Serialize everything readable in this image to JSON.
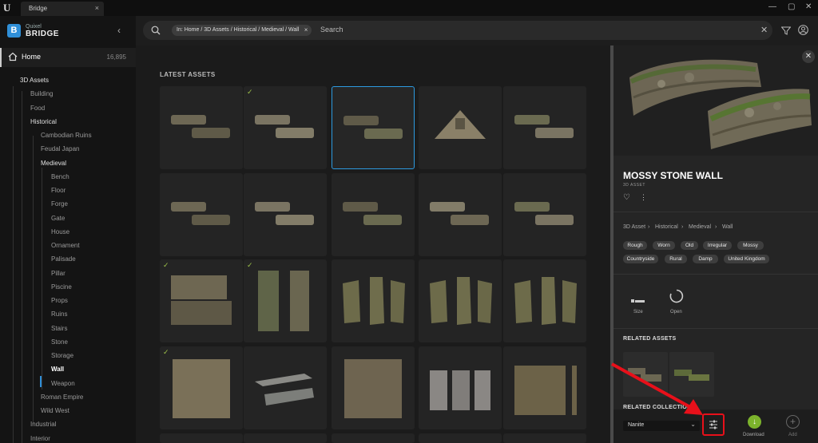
{
  "window": {
    "tab_title": "Bridge",
    "tab_close": "×",
    "minimize": "—",
    "maximize": "▢",
    "close": "✕",
    "ue_logo": "U"
  },
  "brand": {
    "icon_letter": "B",
    "line1": "Quixel",
    "line2": "BRIDGE",
    "collapse": "‹"
  },
  "sidebar": {
    "home": {
      "label": "Home",
      "count": "16,895"
    },
    "items": [
      {
        "label": "3D Assets",
        "level": 0
      },
      {
        "label": "Building",
        "level": 1
      },
      {
        "label": "Food",
        "level": 1
      },
      {
        "label": "Historical",
        "level": 1
      },
      {
        "label": "Cambodian Ruins",
        "level": 2
      },
      {
        "label": "Feudal Japan",
        "level": 2
      },
      {
        "label": "Medieval",
        "level": 2
      },
      {
        "label": "Bench",
        "level": 3
      },
      {
        "label": "Floor",
        "level": 3
      },
      {
        "label": "Forge",
        "level": 3
      },
      {
        "label": "Gate",
        "level": 3
      },
      {
        "label": "House",
        "level": 3
      },
      {
        "label": "Ornament",
        "level": 3
      },
      {
        "label": "Palisade",
        "level": 3
      },
      {
        "label": "Pillar",
        "level": 3
      },
      {
        "label": "Piscine",
        "level": 3
      },
      {
        "label": "Props",
        "level": 3
      },
      {
        "label": "Ruins",
        "level": 3
      },
      {
        "label": "Stairs",
        "level": 3
      },
      {
        "label": "Stone",
        "level": 3
      },
      {
        "label": "Storage",
        "level": 3
      },
      {
        "label": "Wall",
        "level": 3
      },
      {
        "label": "Weapon",
        "level": 3
      },
      {
        "label": "Roman Empire",
        "level": 2
      },
      {
        "label": "Wild West",
        "level": 2
      },
      {
        "label": "Industrial",
        "level": 1
      },
      {
        "label": "Interior",
        "level": 1
      }
    ]
  },
  "search": {
    "chip": "In: Home / 3D Assets / Historical / Medieval / Wall",
    "chip_close": "×",
    "placeholder": "Search",
    "clear": "✕"
  },
  "main": {
    "section_title": "LATEST ASSETS",
    "tiles_checked": [
      1,
      10,
      11,
      15
    ],
    "selected_tile": 2
  },
  "panel": {
    "close": "✕",
    "title": "MOSSY STONE WALL",
    "type": "3D ASSET",
    "heart": "♡",
    "more": "⋮",
    "breadcrumb": [
      "3D Asset",
      "Historical",
      "Medieval",
      "Wall"
    ],
    "crumb_sep": "›",
    "tags": [
      "Rough",
      "Worn",
      "Old",
      "Irregular",
      "Mossy",
      "Countryside",
      "Rural",
      "Damp",
      "United Kingdom"
    ],
    "stats": {
      "size_label": "Size",
      "open_label": "Open"
    },
    "related_assets_title": "RELATED ASSETS",
    "related_collections_title": "RELATED COLLECTIONS",
    "quality": "Nanite",
    "quality_chevron": "⌄",
    "download_label": "Download",
    "add_label": "Add",
    "download_icon": "↓",
    "add_icon": "+"
  },
  "colors": {
    "accent": "#2f8fd8",
    "selected_border": "#2d9ae0",
    "download": "#7cb32c",
    "highlight": "#e8101a",
    "check": "#9ec24a"
  }
}
